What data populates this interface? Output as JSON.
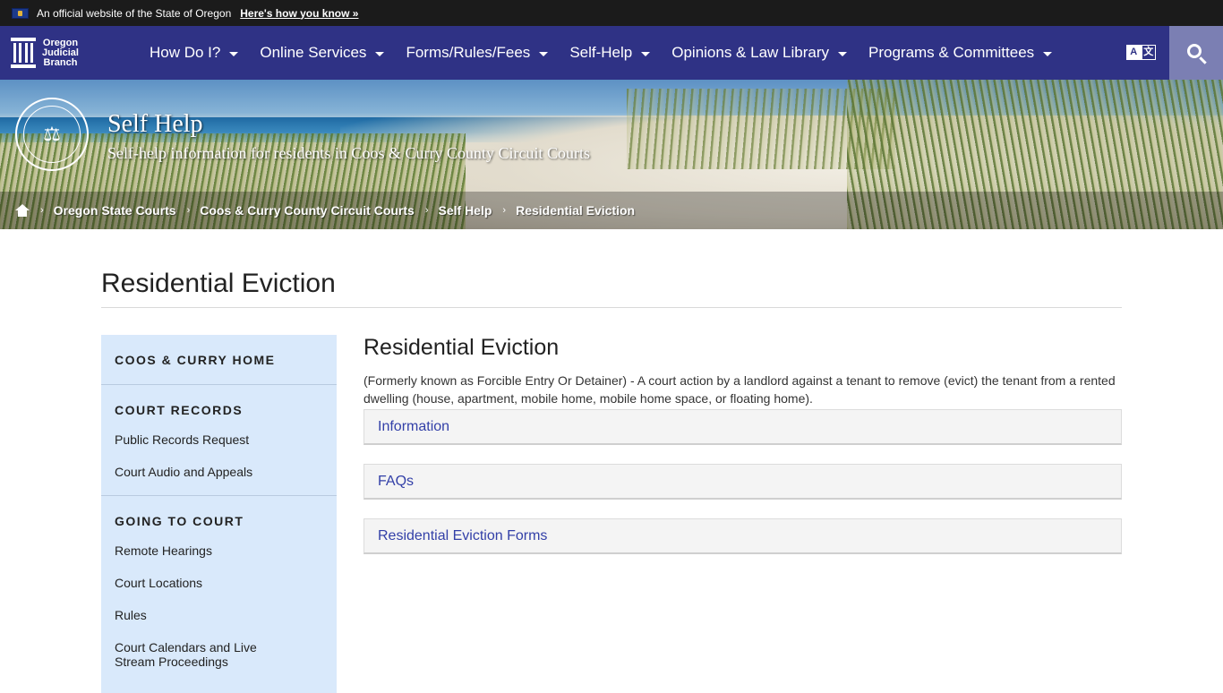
{
  "gov_banner": {
    "text": "An official website of the State of Oregon",
    "link": "Here's how you know »"
  },
  "brand": {
    "line1": "Oregon",
    "line2": "Judicial",
    "line3": "Branch"
  },
  "nav": {
    "items": [
      {
        "label": "How Do I?"
      },
      {
        "label": "Online Services"
      },
      {
        "label": "Forms/Rules/Fees"
      },
      {
        "label": "Self-Help"
      },
      {
        "label": "Opinions & Law Library"
      },
      {
        "label": "Programs & Committees"
      }
    ],
    "translate_a": "A",
    "translate_b": "文",
    "search_icon": "search-icon"
  },
  "hero": {
    "title": "Self Help",
    "subtitle": "Self-help information for residents in Coos & Curry County Circuit Courts",
    "seal_glyph": "⚖"
  },
  "breadcrumb": {
    "items": [
      {
        "label": "Oregon State Courts"
      },
      {
        "label": "Coos & Curry County Circuit Courts"
      },
      {
        "label": "Self Help"
      },
      {
        "label": "Residential Eviction"
      }
    ],
    "separator": "›"
  },
  "page": {
    "title": "Residential Eviction"
  },
  "sidebar": {
    "home": "COOS & CURRY HOME",
    "records_heading": "COURT RECORDS",
    "records_links": [
      "Public Records Request",
      "Court Audio and Appeals"
    ],
    "going_heading": "GOING TO COURT",
    "going_links": [
      "Remote Hearings",
      "Court Locations",
      "Rules",
      "Court Calendars and Live Stream Proceedings"
    ]
  },
  "content": {
    "title": "Residential Eviction",
    "description": "(Formerly known as Forcible Entry Or Detainer) - A court action by a landlord against a tenant to remove (evict) the tenant from a rented dwelling (house, apartment, mobile home, mobile home space, or floating home).",
    "accordions": [
      "Information",
      "FAQs",
      "Residential Eviction Forms"
    ]
  },
  "colors": {
    "nav_bg": "#2f3285",
    "banner_bg": "#1b1b1b",
    "sidebar_bg": "#d9e9fb",
    "accordion_link": "#3340a8"
  }
}
